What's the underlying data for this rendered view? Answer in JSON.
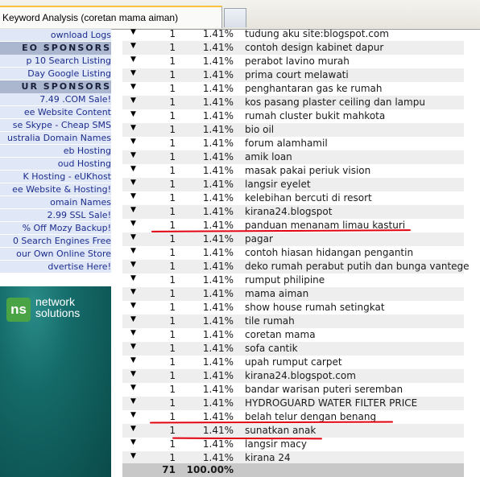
{
  "tab": {
    "title": "Keyword Analysis (coretan mama aiman)"
  },
  "sidebar": {
    "items": [
      {
        "type": "item",
        "label": "ownload Logs"
      },
      {
        "type": "head",
        "label": "EO SPONSORS"
      },
      {
        "type": "item",
        "label": "p 10 Search Listing"
      },
      {
        "type": "item",
        "label": "Day Google Listing"
      },
      {
        "type": "head",
        "label": "UR SPONSORS"
      },
      {
        "type": "item",
        "label": "7.49 .COM Sale!"
      },
      {
        "type": "item",
        "label": "ee Website Content"
      },
      {
        "type": "item",
        "label": "se Skype - Cheap SMS"
      },
      {
        "type": "item",
        "label": "ustralia Domain Names"
      },
      {
        "type": "item",
        "label": "eb Hosting"
      },
      {
        "type": "item",
        "label": "oud Hosting"
      },
      {
        "type": "item",
        "label": "K Hosting - eUKhost"
      },
      {
        "type": "item",
        "label": "ee Website & Hosting!"
      },
      {
        "type": "item",
        "label": "omain Names"
      },
      {
        "type": "item",
        "label": "2.99 SSL Sale!"
      },
      {
        "type": "item",
        "label": "% Off Mozy Backup!"
      },
      {
        "type": "item",
        "label": "0 Search Engines Free"
      },
      {
        "type": "item",
        "label": "our Own Online Store"
      },
      {
        "type": "item",
        "label": "dvertise Here!"
      }
    ],
    "ad": {
      "logo_text": "ns",
      "name_line1": "network",
      "name_line2": "solutions"
    }
  },
  "table": {
    "rows": [
      {
        "count": "1",
        "percent": "1.41%",
        "keyword": "tudung aku site:blogspot.com"
      },
      {
        "count": "1",
        "percent": "1.41%",
        "keyword": "contoh design kabinet dapur"
      },
      {
        "count": "1",
        "percent": "1.41%",
        "keyword": "perabot lavino murah"
      },
      {
        "count": "1",
        "percent": "1.41%",
        "keyword": "prima court melawati"
      },
      {
        "count": "1",
        "percent": "1.41%",
        "keyword": "penghantaran gas ke rumah"
      },
      {
        "count": "1",
        "percent": "1.41%",
        "keyword": "kos pasang plaster ceiling dan lampu"
      },
      {
        "count": "1",
        "percent": "1.41%",
        "keyword": "rumah cluster bukit mahkota"
      },
      {
        "count": "1",
        "percent": "1.41%",
        "keyword": "bio oil"
      },
      {
        "count": "1",
        "percent": "1.41%",
        "keyword": "forum alamhamil"
      },
      {
        "count": "1",
        "percent": "1.41%",
        "keyword": "amik loan"
      },
      {
        "count": "1",
        "percent": "1.41%",
        "keyword": "masak pakai periuk vision"
      },
      {
        "count": "1",
        "percent": "1.41%",
        "keyword": "langsir eyelet"
      },
      {
        "count": "1",
        "percent": "1.41%",
        "keyword": "kelebihan bercuti di resort"
      },
      {
        "count": "1",
        "percent": "1.41%",
        "keyword": "kirana24.blogspot"
      },
      {
        "count": "1",
        "percent": "1.41%",
        "keyword": "panduan menanam limau kasturi"
      },
      {
        "count": "1",
        "percent": "1.41%",
        "keyword": "pagar"
      },
      {
        "count": "1",
        "percent": "1.41%",
        "keyword": "contoh hiasan hidangan pengantin"
      },
      {
        "count": "1",
        "percent": "1.41%",
        "keyword": "deko rumah perabut putih dan bunga vantege"
      },
      {
        "count": "1",
        "percent": "1.41%",
        "keyword": "rumput philipine"
      },
      {
        "count": "1",
        "percent": "1.41%",
        "keyword": "mama aiman"
      },
      {
        "count": "1",
        "percent": "1.41%",
        "keyword": "show house rumah setingkat"
      },
      {
        "count": "1",
        "percent": "1.41%",
        "keyword": "tile rumah"
      },
      {
        "count": "1",
        "percent": "1.41%",
        "keyword": "coretan mama"
      },
      {
        "count": "1",
        "percent": "1.41%",
        "keyword": "sofa cantik"
      },
      {
        "count": "1",
        "percent": "1.41%",
        "keyword": "upah rumput carpet"
      },
      {
        "count": "1",
        "percent": "1.41%",
        "keyword": "kirana24.blogspot.com"
      },
      {
        "count": "1",
        "percent": "1.41%",
        "keyword": "bandar warisan puteri seremban"
      },
      {
        "count": "1",
        "percent": "1.41%",
        "keyword": "HYDROGUARD WATER FILTER PRICE"
      },
      {
        "count": "1",
        "percent": "1.41%",
        "keyword": "belah telur dengan benang"
      },
      {
        "count": "1",
        "percent": "1.41%",
        "keyword": "sunatkan anak"
      },
      {
        "count": "1",
        "percent": "1.41%",
        "keyword": "langsir macy"
      },
      {
        "count": "1",
        "percent": "1.41%",
        "keyword": "kirana 24"
      }
    ],
    "totals": {
      "count": "71",
      "percent": "100.00%"
    },
    "arrow_glyph": "▼"
  },
  "colors": {
    "annotation_red": "#e0000f",
    "sidebar_bg": "#e0e8f8",
    "sidebar_link": "#1c2c8c",
    "tab_accent": "#f9c341"
  }
}
